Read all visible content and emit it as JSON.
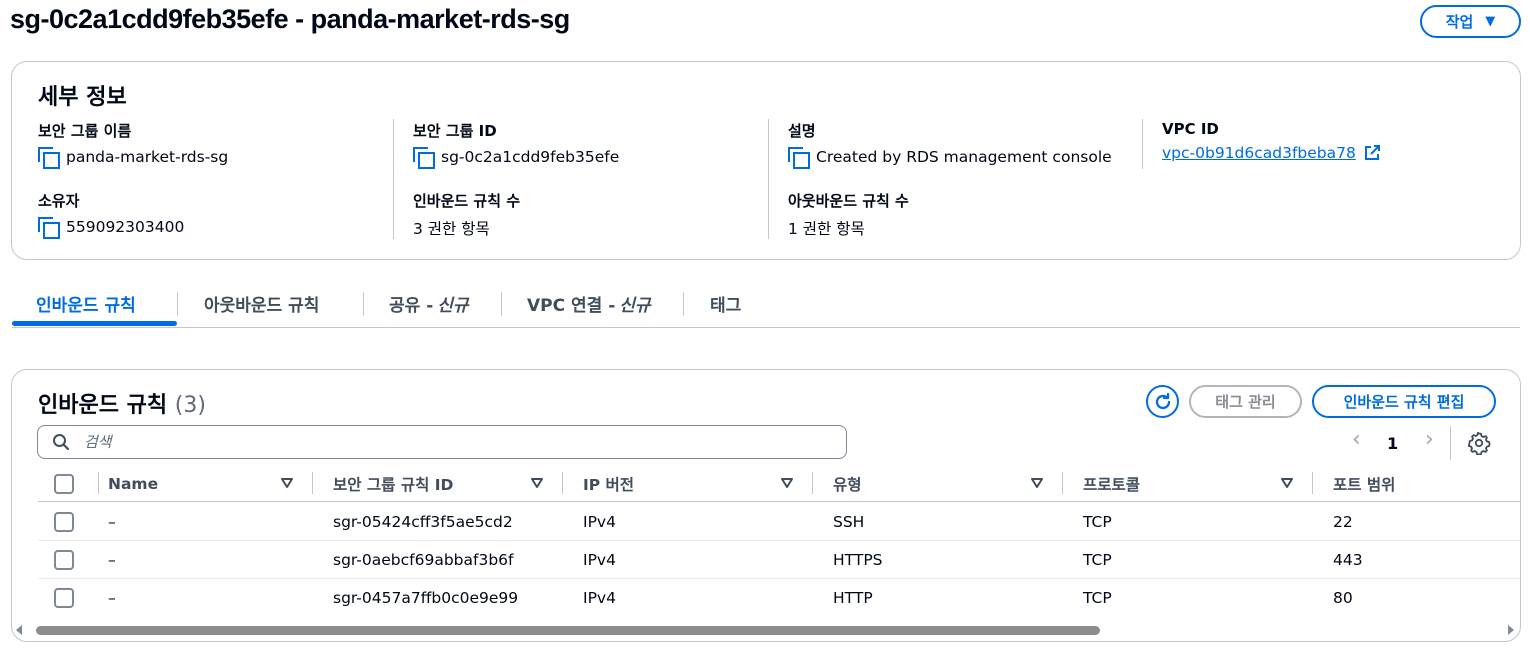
{
  "page": {
    "title": "sg-0c2a1cdd9feb35efe - panda-market-rds-sg",
    "actions_label": "작업",
    "actions_caret": "▼"
  },
  "details": {
    "title": "세부 정보",
    "fields": {
      "sg_name": {
        "label": "보안 그룹 이름",
        "value": "panda-market-rds-sg"
      },
      "sg_id": {
        "label": "보안 그룹 ID",
        "value": "sg-0c2a1cdd9feb35efe"
      },
      "description": {
        "label": "설명",
        "value": "Created by RDS management console"
      },
      "vpc_id": {
        "label": "VPC ID",
        "value": "vpc-0b91d6cad3fbeba78"
      },
      "owner": {
        "label": "소유자",
        "value": "559092303400"
      },
      "inbound_count": {
        "label": "인바운드 규칙 수",
        "value": "3 권한 항목"
      },
      "outbound_count": {
        "label": "아웃바운드 규칙 수",
        "value": "1 권한 항목"
      }
    }
  },
  "tabs": [
    {
      "label": "인바운드 규칙",
      "suffix": ""
    },
    {
      "label": "아웃바운드 규칙",
      "suffix": ""
    },
    {
      "label": "공유 -",
      "suffix": "신규"
    },
    {
      "label": "VPC 연결 -",
      "suffix": "신규"
    },
    {
      "label": "태그",
      "suffix": ""
    }
  ],
  "active_tab": "인바운드 규칙",
  "rules": {
    "title": "인바운드 규칙",
    "count": "(3)",
    "manage_tags_label": "태그 관리",
    "edit_label": "인바운드 규칙 편집",
    "search_placeholder": "검색",
    "pagination": {
      "prev": "‹",
      "page": "1",
      "next": "›"
    },
    "columns": [
      "Name",
      "보안 그룹 규칙 ID",
      "IP 버전",
      "유형",
      "프로토콜",
      "포트 범위"
    ],
    "rows": [
      {
        "name": "–",
        "rule_id": "sgr-05424cff3f5ae5cd2",
        "ip_version": "IPv4",
        "type": "SSH",
        "protocol": "TCP",
        "port_range": "22"
      },
      {
        "name": "–",
        "rule_id": "sgr-0aebcf69abbaf3b6f",
        "ip_version": "IPv4",
        "type": "HTTPS",
        "protocol": "TCP",
        "port_range": "443"
      },
      {
        "name": "–",
        "rule_id": "sgr-0457a7ffb0c0e9e99",
        "ip_version": "IPv4",
        "type": "HTTP",
        "protocol": "TCP",
        "port_range": "80"
      }
    ]
  },
  "colors": {
    "accent": "#006ce0",
    "text": "#000716",
    "border": "#c6c6cd",
    "disabled": "#8c8c94"
  },
  "icons": [
    "copy-icon",
    "external-link-icon",
    "refresh-icon",
    "search-icon",
    "settings-icon",
    "sort-icon",
    "chevron-left-icon",
    "chevron-right-icon"
  ]
}
